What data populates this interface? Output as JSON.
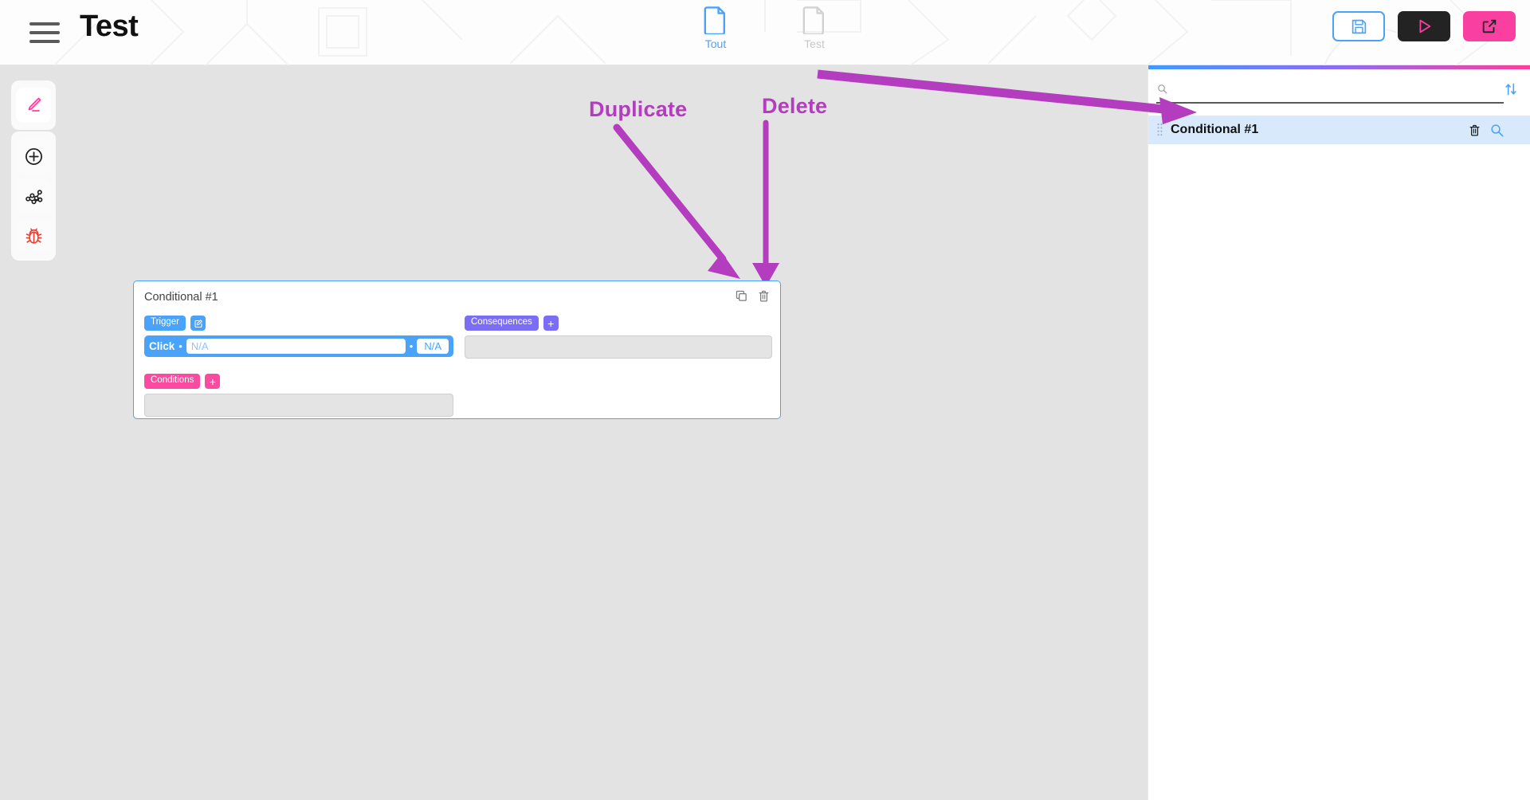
{
  "header": {
    "menu_icon": "hamburger-icon",
    "title": "Test",
    "tabs": [
      {
        "label": "Tout",
        "icon": "file-icon",
        "active": true
      },
      {
        "label": "Test",
        "icon": "file-icon",
        "active": false
      }
    ],
    "actions": [
      {
        "name": "save-button",
        "icon": "floppy-disk-icon",
        "bg": "#ffffff",
        "fg": "#4aa3fb"
      },
      {
        "name": "preview-button",
        "icon": "play-triangle-icon",
        "bg": "#232323",
        "fg": "#f93fa0"
      },
      {
        "name": "open-external-button",
        "icon": "external-link-icon",
        "bg": "#f93fa0",
        "fg": "#232323"
      }
    ]
  },
  "left_toolbar": {
    "tools": [
      {
        "name": "pen-tool",
        "icon": "pen-icon",
        "color": "#fb3f9a",
        "active": true
      },
      {
        "name": "add-element-tool",
        "icon": "plus-circle-icon",
        "color": "#222222",
        "active": false
      },
      {
        "name": "workflow-tool",
        "icon": "nodes-icon",
        "color": "#222222",
        "active": false
      },
      {
        "name": "debug-tool",
        "icon": "bug-icon",
        "color": "#ef3b2d",
        "active": false
      }
    ]
  },
  "annotations": [
    {
      "label": "Duplicate",
      "color": "#b43cbe"
    },
    {
      "label": "Delete",
      "color": "#b43cbe"
    }
  ],
  "canvas": {
    "card": {
      "title": "Conditional #1",
      "header_icons": [
        {
          "name": "duplicate-icon",
          "icon": "copy-icon"
        },
        {
          "name": "delete-icon",
          "icon": "trash-icon"
        }
      ],
      "trigger": {
        "badge": "Trigger",
        "edit_icon": "edit-square-icon",
        "event": "Click",
        "separator": "•",
        "target_value": "N/A",
        "param_value": "N/A"
      },
      "conditions": {
        "badge": "Conditions",
        "add_icon": "plus-icon",
        "dropzone_empty": ""
      },
      "consequences": {
        "badge": "Consequences",
        "add_icon": "plus-icon",
        "dropzone_empty": ""
      }
    }
  },
  "right_panel": {
    "search": {
      "icon": "search-icon",
      "value": "",
      "placeholder": ""
    },
    "sort_icon": "sort-arrows-icon",
    "items": [
      {
        "label": "Conditional #1",
        "drag_icon": "drag-handle-icon",
        "delete_icon": "trash-icon",
        "inspect_icon": "search-icon",
        "selected": true
      }
    ]
  },
  "colors": {
    "accent_blue": "#4aa3fb",
    "accent_pink": "#fb3f9a",
    "accent_purple": "#7c6df6",
    "annotation": "#b43cbe",
    "canvas_bg": "#e3e3e3",
    "selection_bg": "#d9e9fc"
  }
}
